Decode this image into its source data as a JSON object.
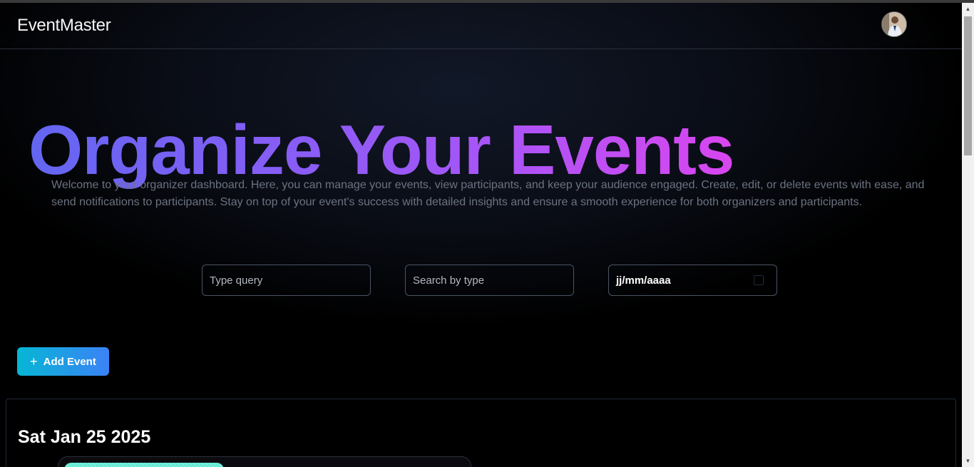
{
  "navbar": {
    "brand": "EventMaster",
    "avatar_alt": "User profile"
  },
  "hero": {
    "title": "Organize Your Events",
    "description": "Welcome to your organizer dashboard. Here, you can manage your events, view participants, and keep your audience engaged. Create, edit, or delete events with ease, and send notifications to participants. Stay on top of your event's success with detailed insights and ensure a smooth experience for both organizers and participants."
  },
  "filters": {
    "query_placeholder": "Type query",
    "type_placeholder": "Search by type",
    "date_value": "jj/mm/aaaa"
  },
  "actions": {
    "add_event_label": "Add Event"
  },
  "events": {
    "date_heading": "Sat Jan 25 2025"
  },
  "colors": {
    "title_gradient_start": "#6366f1",
    "title_gradient_end": "#d946ef",
    "button_gradient_start": "#06b6d4",
    "button_gradient_end": "#3b82f6",
    "card_banner": "#5eead4"
  },
  "icons": {
    "add": "plus-icon",
    "date": "calendar-icon"
  }
}
